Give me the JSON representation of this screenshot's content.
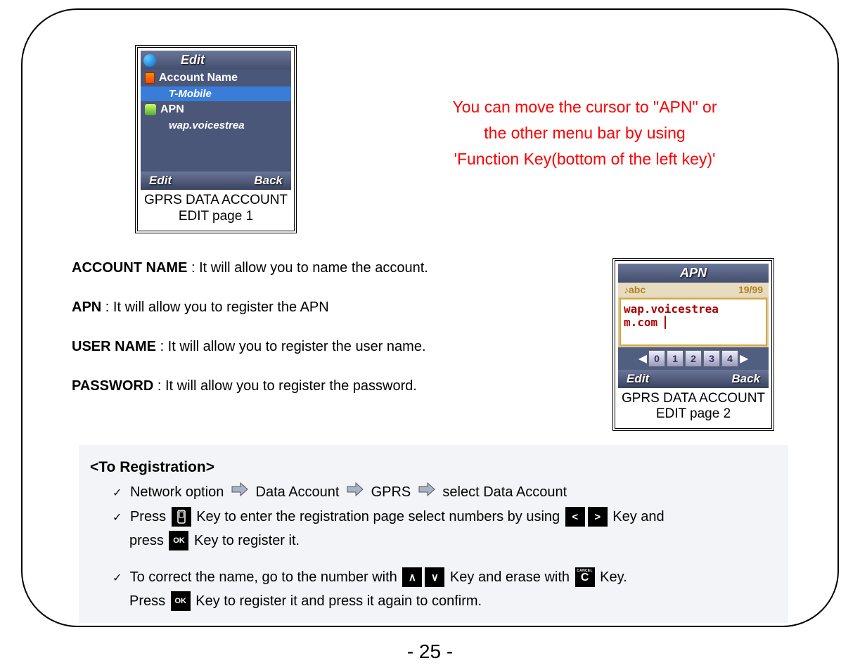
{
  "phone1": {
    "header": "Edit",
    "items": {
      "account_name": "Account Name",
      "tmobile": "T-Mobile",
      "apn": "APN",
      "wap": "wap.voicestrea"
    },
    "footer_left": "Edit",
    "footer_right": "Back",
    "caption_l1": "GPRS DATA ACCOUNT",
    "caption_l2": "EDIT page 1"
  },
  "red_note": {
    "l1": "You can move the cursor to \"APN\" or",
    "l2": "the other menu bar by using",
    "l3": "'Function Key(bottom of the left key)'"
  },
  "defs": {
    "account_name_label": "ACCOUNT NAME",
    "account_name_text": " : It will allow you to name the account.",
    "apn_label": "APN",
    "apn_text": " : It will allow you to register the APN",
    "user_label": "USER NAME",
    "user_text": " : It will allow you to register the user name.",
    "pass_label": "PASSWORD",
    "pass_text": " : It will allow you to register the password."
  },
  "phone2": {
    "header": "APN",
    "mode": "abc",
    "count": "19/99",
    "text_l1": "wap.voicestrea",
    "text_l2": "m.com",
    "keys": [
      "0",
      "1",
      "2",
      "3",
      "4"
    ],
    "footer_left": "Edit",
    "footer_right": "Back",
    "caption_l1": "GPRS DATA ACCOUNT",
    "caption_l2": "EDIT page 2"
  },
  "reg": {
    "title": "<To Registration>",
    "l1_a": "Network option ",
    "l1_b": " Data Account ",
    "l1_c": " GPRS ",
    "l1_d": " select Data Account",
    "l2_a": "Press ",
    "l2_b": " Key to enter the registration page  select numbers by using ",
    "l2_c": " Key and",
    "l3_a": "press ",
    "l3_b": " Key to register it.",
    "l4_a": "To correct the name, go to the number with ",
    "l4_b": " Key and erase with ",
    "l4_c": " Key.",
    "l5_a": "Press ",
    "l5_b": " Key to register it and press it again to confirm.",
    "ok": "OK",
    "cancel_c": "C",
    "cancel_label": "CANCEL"
  },
  "page_num": "- 25 -"
}
